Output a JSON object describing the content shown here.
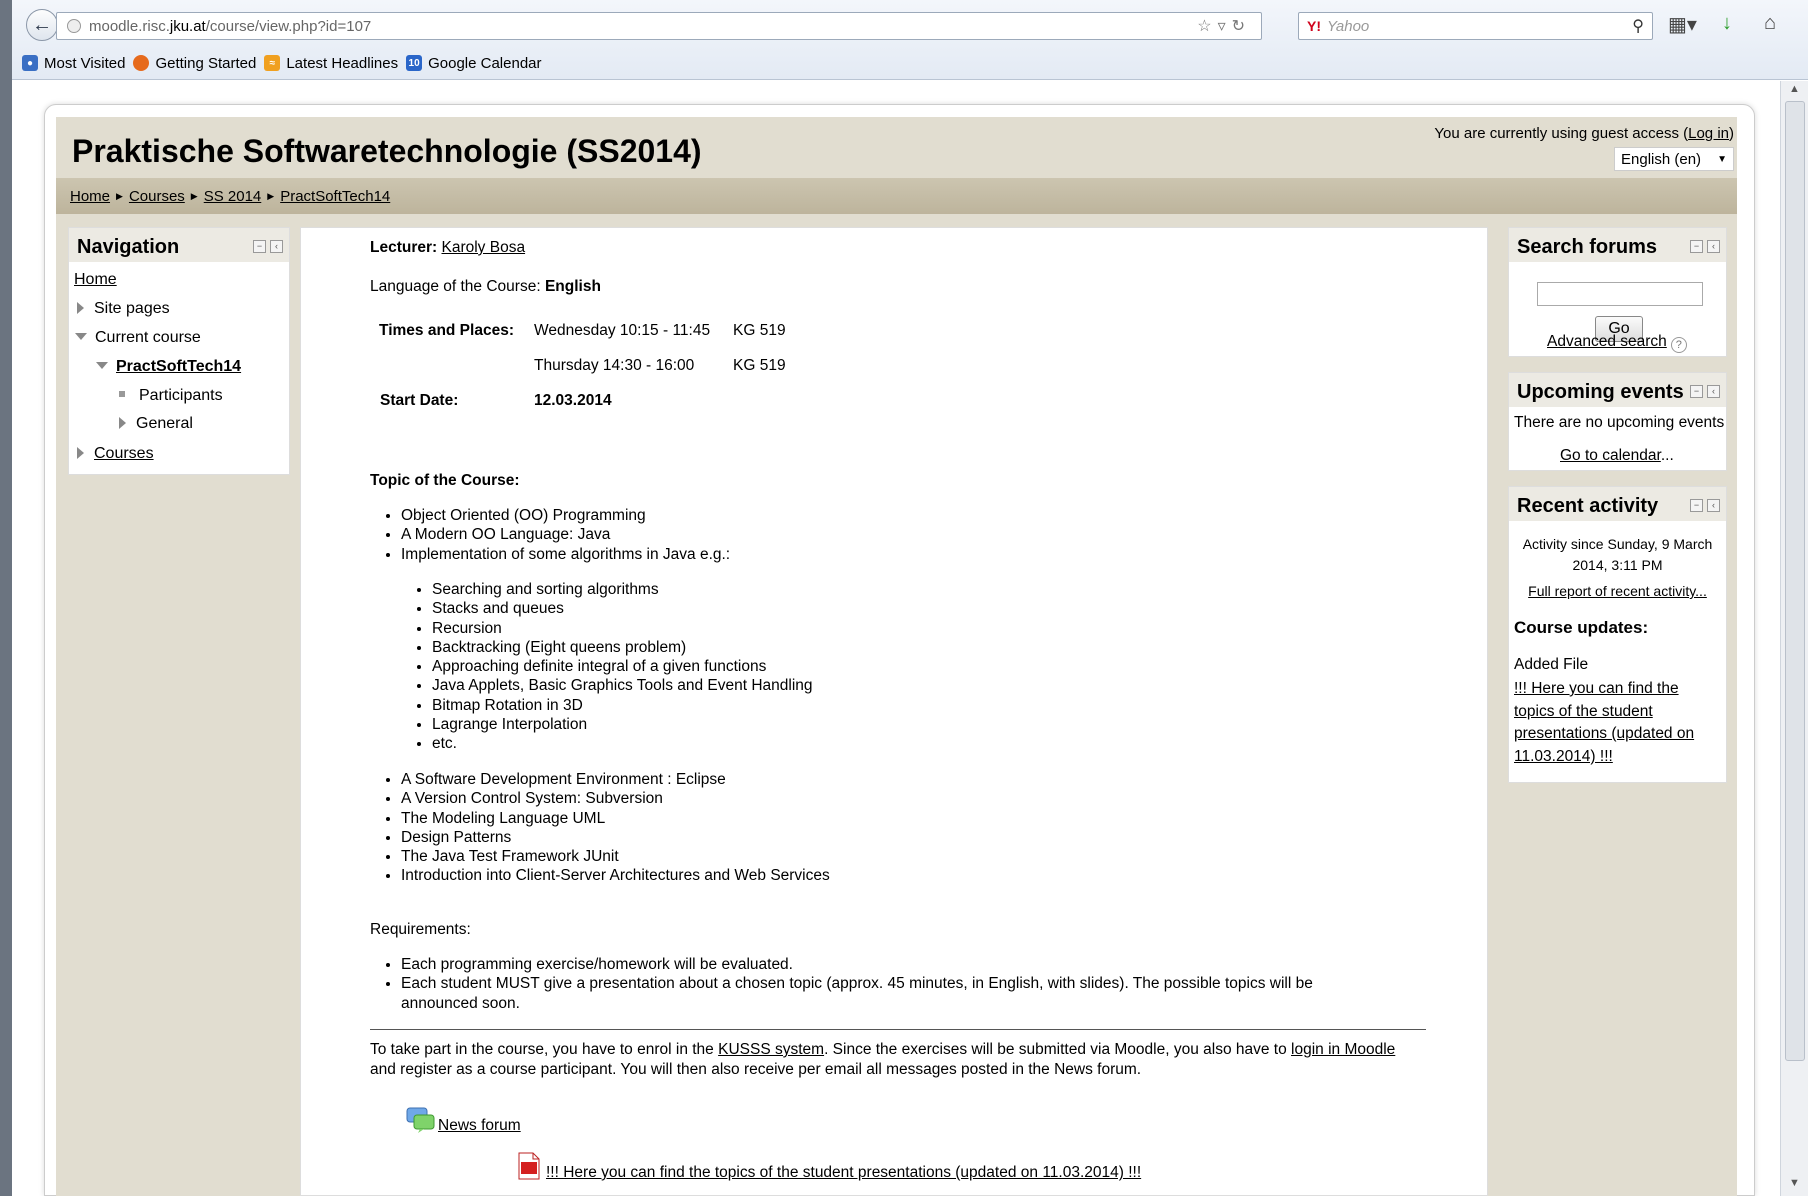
{
  "browser": {
    "url_prefix": "moodle.risc.",
    "url_host": "jku.at",
    "url_path": "/course/view.php?id=107",
    "search_placeholder": "Yahoo",
    "search_engine_logo": "Y!",
    "bookmarks": [
      {
        "label": "Most Visited",
        "icon": "most-visited-icon",
        "color": "#3a6fc4"
      },
      {
        "label": "Getting Started",
        "icon": "firefox-icon",
        "color": "#e66a1c"
      },
      {
        "label": "Latest Headlines",
        "icon": "rss-icon",
        "color": "#f0a020"
      },
      {
        "label": "Google Calendar",
        "icon": "calendar-icon",
        "color": "#2a66c9",
        "badge": "10"
      }
    ]
  },
  "header": {
    "title": "Praktische Softwaretechnologie (SS2014)",
    "guest_text": "You are currently using guest access (",
    "login_link": "Log in",
    "guest_close": ")",
    "language": "English (en)"
  },
  "breadcrumb": [
    "Home",
    "Courses",
    "SS 2014",
    "PractSoftTech14"
  ],
  "navigation": {
    "title": "Navigation",
    "home": "Home",
    "site_pages": "Site pages",
    "current_course": "Current course",
    "course_code": "PractSoftTech14",
    "participants": "Participants",
    "general": "General",
    "courses": "Courses"
  },
  "main": {
    "lecturer_label": "Lecturer:",
    "lecturer_name": "Karoly Bosa",
    "language_label": "Language of the Course:",
    "language_value": "English",
    "times_label": "Times and Places:",
    "time1": "Wednesday 10:15 - 11:45",
    "room1": "KG 519",
    "time2": "Thursday 14:30 - 16:00",
    "room2": "KG 519",
    "start_label": "Start Date:",
    "start_value": "12.03.2014",
    "topic_heading": "Topic of the Course:",
    "topics_top": [
      "Object Oriented (OO) Programming",
      "A Modern OO Language: Java",
      "Implementation of some algorithms in Java e.g.:"
    ],
    "algorithms": [
      "Searching and sorting algorithms",
      "Stacks and queues",
      "Recursion",
      "Backtracking (Eight queens problem)",
      "Approaching definite integral of a given functions",
      "Java Applets, Basic Graphics Tools and Event Handling",
      "Bitmap Rotation in 3D",
      "Lagrange Interpolation",
      "etc."
    ],
    "topics_bottom": [
      "A Software Development Environment : Eclipse",
      "A Version Control System: Subversion",
      "The Modeling Language UML",
      "Design Patterns",
      "The Java Test Framework JUnit",
      "Introduction into Client-Server Architectures and Web Services"
    ],
    "requirements_label": "Requirements:",
    "req1": "Each programming exercise/homework will be evaluated.",
    "req2_line1": "Each student MUST give a presentation about a chosen topic (approx. 45 minutes, in English, with slides). The possible topics will be",
    "req2_line2": "announced soon.",
    "enrol_part1": "To take part in the course, you have to enrol in the ",
    "enrol_link1": "KUSSS system",
    "enrol_part2": ". Since the exercises will be submitted via Moodle, you also have to ",
    "enrol_link2": "login in Moodle",
    "enrol_line2": "and register as a course participant. You will then also receive per email all messages posted in the News forum.",
    "news_forum": "News forum",
    "file_link": "!!! Here you can find the topics of the student presentations (updated on 11.03.2014) !!!"
  },
  "search_forums": {
    "title": "Search forums",
    "go": "Go",
    "advanced": "Advanced search"
  },
  "upcoming": {
    "title": "Upcoming events",
    "none": "There are no upcoming events",
    "calendar_link": "Go to calendar",
    "ellipsis": "..."
  },
  "recent": {
    "title": "Recent activity",
    "since_line1": "Activity since Sunday, 9 March",
    "since_line2": "2014, 3:11 PM",
    "full_report": "Full report of recent activity...",
    "updates_heading": "Course updates:",
    "added": "Added File",
    "file_line1": "!!! Here you can find the",
    "file_line2": "topics of the student",
    "file_line3": "presentations (updated on",
    "file_line4": "11.03.2014) !!!"
  }
}
